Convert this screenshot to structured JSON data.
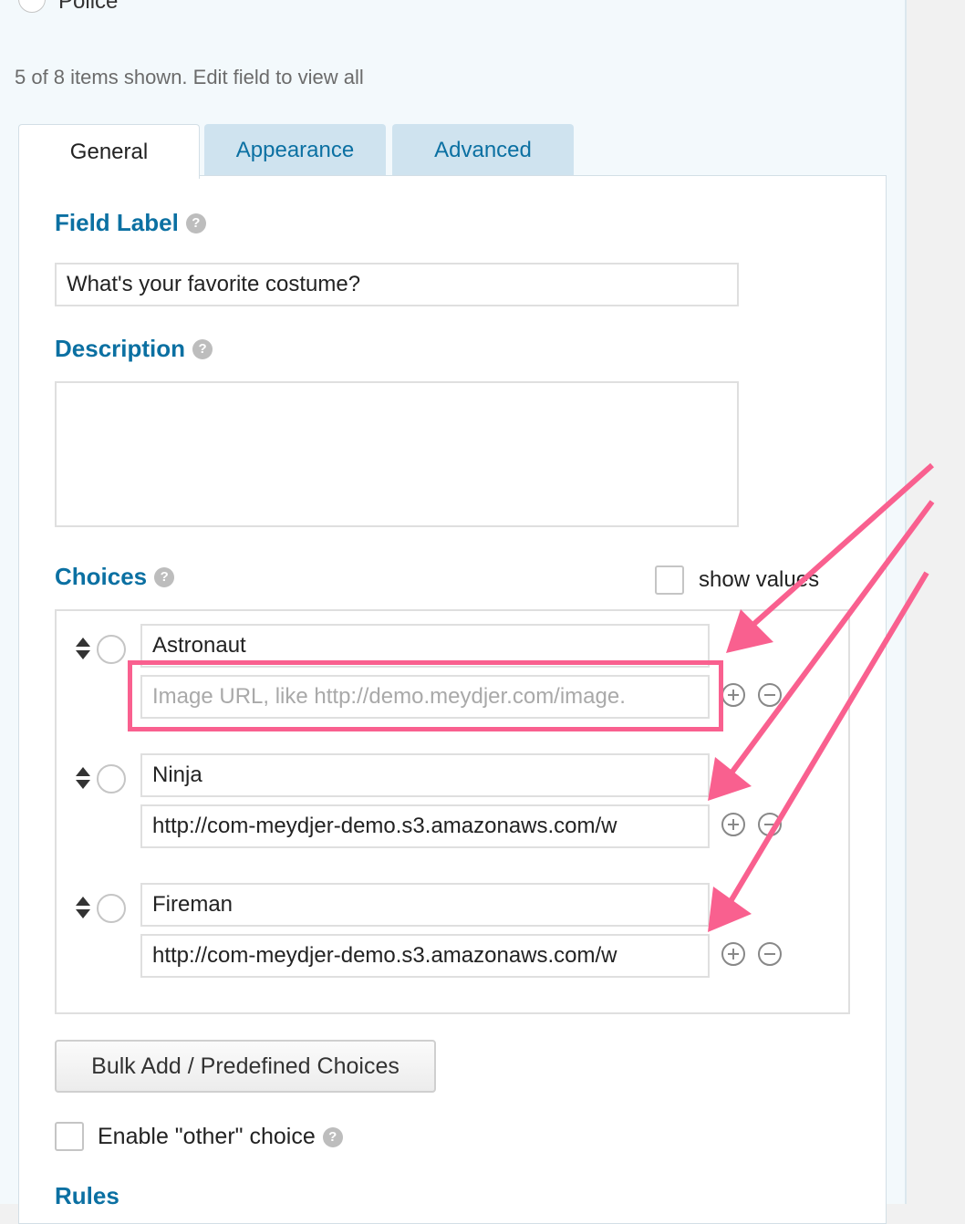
{
  "top_option": {
    "label": "Police"
  },
  "items_note": "5 of 8 items shown. Edit field to view all",
  "tabs": [
    {
      "label": "General",
      "active": true
    },
    {
      "label": "Appearance",
      "active": false
    },
    {
      "label": "Advanced",
      "active": false
    }
  ],
  "field_label": {
    "heading": "Field Label",
    "value": "What's your favorite costume?"
  },
  "description": {
    "heading": "Description",
    "value": ""
  },
  "choices": {
    "heading": "Choices",
    "show_values_label": "show values",
    "show_values_checked": false,
    "items": [
      {
        "label": "Astronaut",
        "image_url": "",
        "image_placeholder": "Image URL, like http://demo.meydjer.com/image."
      },
      {
        "label": "Ninja",
        "image_url": "http://com-meydjer-demo.s3.amazonaws.com/w",
        "image_placeholder": ""
      },
      {
        "label": "Fireman",
        "image_url": "http://com-meydjer-demo.s3.amazonaws.com/w",
        "image_placeholder": ""
      }
    ]
  },
  "bulk_add_button": "Bulk Add / Predefined Choices",
  "enable_other": {
    "label": "Enable \"other\" choice",
    "checked": false
  },
  "rules_heading": "Rules",
  "colors": {
    "accent": "#0b70a2",
    "highlight": "#f9608f",
    "panel_bg": "#f3f9fc",
    "tab_inactive": "#cfe3ef"
  }
}
